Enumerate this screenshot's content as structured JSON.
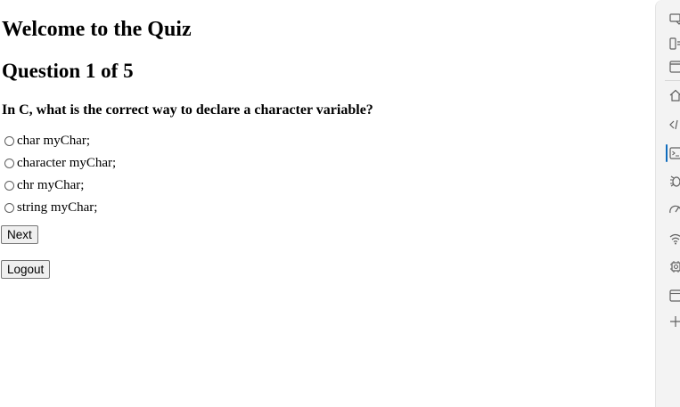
{
  "quiz": {
    "heading": "Welcome to the Quiz",
    "question_counter": "Question 1 of 5",
    "question_text": "In C, what is the correct way to declare a character variable?",
    "options": [
      "char myChar;",
      "character myChar;",
      "chr myChar;",
      "string myChar;"
    ],
    "next_label": "Next",
    "logout_label": "Logout"
  },
  "sidebar": {
    "icons": [
      "cast-icon",
      "device-emulation-icon",
      "window-icon",
      "home-icon",
      "code-icon",
      "console-icon",
      "bug-icon",
      "performance-icon",
      "wifi-icon",
      "chip-icon",
      "application-icon",
      "add-icon"
    ],
    "active_color": "#0f6cbd"
  }
}
